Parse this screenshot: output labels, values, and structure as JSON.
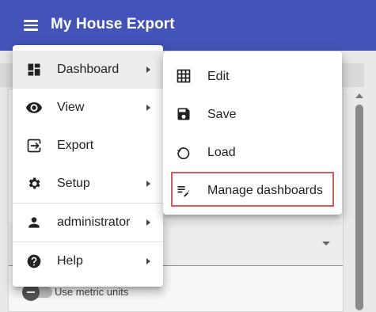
{
  "app": {
    "title": "My House Export"
  },
  "main_menu": {
    "items": [
      {
        "label": "Dashboard",
        "icon": "dashboard-icon",
        "has_submenu": true,
        "active": true
      },
      {
        "label": "View",
        "icon": "eye-icon",
        "has_submenu": true
      },
      {
        "label": "Export",
        "icon": "export-icon",
        "has_submenu": false
      },
      {
        "label": "Setup",
        "icon": "gear-icon",
        "has_submenu": true
      },
      {
        "label": "administrator",
        "icon": "person-icon",
        "has_submenu": true
      },
      {
        "label": "Help",
        "icon": "help-icon",
        "has_submenu": true
      }
    ]
  },
  "dashboard_submenu": {
    "items": [
      {
        "label": "Edit",
        "icon": "grid-icon"
      },
      {
        "label": "Save",
        "icon": "save-icon"
      },
      {
        "label": "Load",
        "icon": "restore-icon"
      },
      {
        "label": "Manage dashboards",
        "icon": "playlist-edit-icon",
        "highlighted": true
      }
    ]
  },
  "background": {
    "toggle_label": "Use metric units"
  },
  "colors": {
    "app_bar": "#4353b9",
    "highlight": "#e05a55"
  }
}
